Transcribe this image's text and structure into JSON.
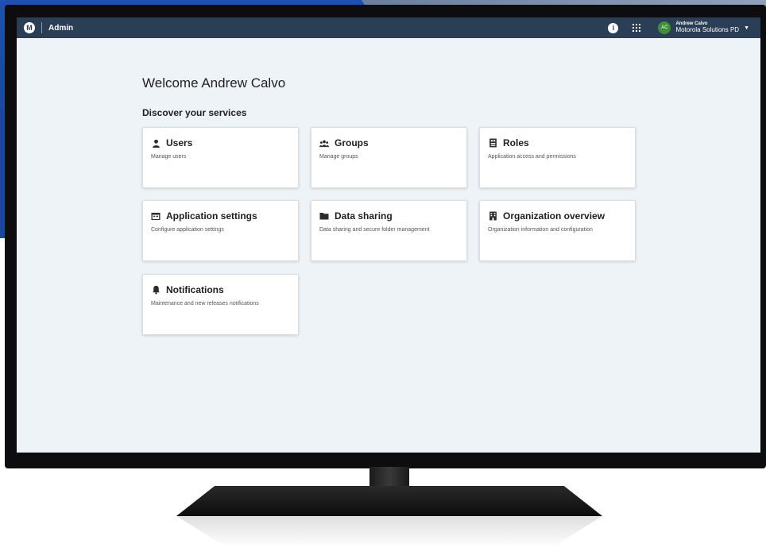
{
  "topbar": {
    "app_title": "Admin",
    "user_initials": "AC",
    "user_name": "Andrew Calvo",
    "user_org": "Motorola Solutions PD"
  },
  "main": {
    "welcome": "Welcome Andrew Calvo",
    "section_title": "Discover your services",
    "cards": [
      {
        "title": "Users",
        "desc": "Manage users",
        "icon": "user-icon"
      },
      {
        "title": "Groups",
        "desc": "Manage groups",
        "icon": "groups-icon"
      },
      {
        "title": "Roles",
        "desc": "Application access and permissions",
        "icon": "roles-icon"
      },
      {
        "title": "Application settings",
        "desc": "Configure application settings",
        "icon": "app-settings-icon"
      },
      {
        "title": "Data sharing",
        "desc": "Data sharing and secure folder management",
        "icon": "folder-icon"
      },
      {
        "title": "Organization overview",
        "desc": "Organization information and configuration",
        "icon": "building-icon"
      },
      {
        "title": "Notifications",
        "desc": "Maintenance and new releases notifications",
        "icon": "bell-icon"
      }
    ]
  },
  "colors": {
    "topbar": "#2a3e55",
    "screen_bg": "#eef3f7",
    "avatar": "#3f8f3a",
    "backdrop_blue": "#1f4fb0"
  }
}
